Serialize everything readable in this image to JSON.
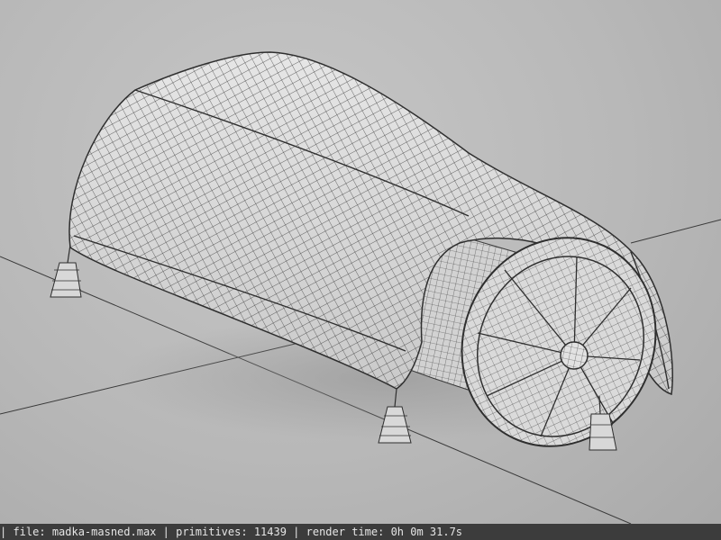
{
  "render_info": {
    "file_label": "file:",
    "file_name": "madka-masned.max",
    "primitives_label": "primitives:",
    "primitives_value": "11439",
    "render_time_label": "render time:",
    "render_time_value": "0h  0m 31.7s"
  },
  "colors": {
    "background": "#b9b9b9",
    "mesh_fill": "#dcdcdc",
    "wire": "#3a3a3a",
    "status_bar": "#3c3c3c",
    "status_text": "#e6e6e6"
  }
}
